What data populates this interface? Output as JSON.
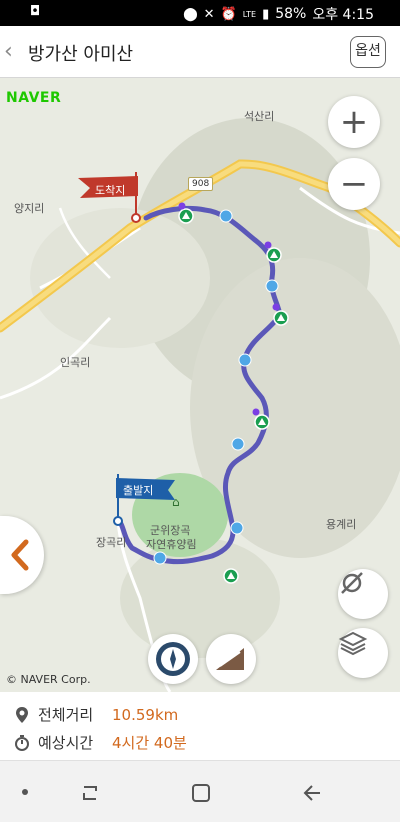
{
  "status_bar": {
    "battery": "58%",
    "network": "LTE",
    "time": "오후 4:15"
  },
  "header": {
    "title": "방가산 아미산",
    "options_label": "옵션"
  },
  "map": {
    "brand": "NAVER",
    "copyright": "© NAVER Corp.",
    "road_number": "908",
    "places": {
      "seoksan": "석산리",
      "yangji": "양지리",
      "ingok": "인곡리",
      "janggok": "장곡리",
      "yonggye": "용계리",
      "forest_1": "군위장곡",
      "forest_2": "자연휴양림"
    },
    "flags": {
      "end": "도착지",
      "start": "출발지"
    }
  },
  "route_info": {
    "distance_label": "전체거리",
    "distance_value": "10.59km",
    "time_label": "예상시간",
    "time_value": "4시간 40분"
  },
  "colors": {
    "route": "#5b58b8",
    "accent_orange": "#d2691e",
    "flag_end": "#c0392b",
    "flag_start": "#1e5fa8",
    "naver_green": "#1ec800",
    "peak_green": "#1a9e50"
  }
}
